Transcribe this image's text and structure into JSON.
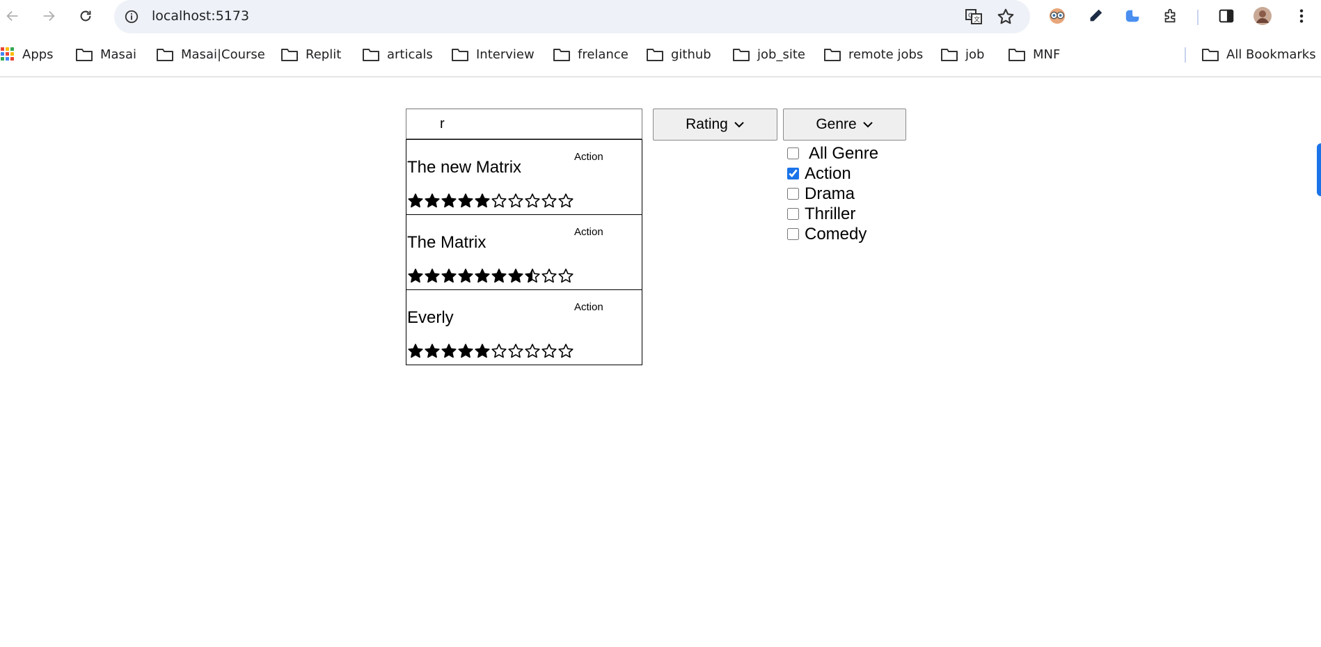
{
  "browser": {
    "url": "localhost:5173",
    "bookmarks": [
      {
        "label": "Apps",
        "icon": "apps-grid-icon"
      },
      {
        "label": "Masai",
        "icon": "folder-icon"
      },
      {
        "label": "Masai|Course",
        "icon": "folder-icon"
      },
      {
        "label": "Replit",
        "icon": "folder-icon"
      },
      {
        "label": "articals",
        "icon": "folder-icon"
      },
      {
        "label": "Interview",
        "icon": "folder-icon"
      },
      {
        "label": "frelance",
        "icon": "folder-icon"
      },
      {
        "label": "github",
        "icon": "folder-icon"
      },
      {
        "label": "job_site",
        "icon": "folder-icon"
      },
      {
        "label": "remote jobs",
        "icon": "folder-icon"
      },
      {
        "label": "job",
        "icon": "folder-icon"
      },
      {
        "label": "MNF",
        "icon": "folder-icon"
      }
    ],
    "all_bookmarks_label": "All Bookmarks"
  },
  "search": {
    "value": "r"
  },
  "rating_dropdown": {
    "label": "Rating"
  },
  "genre_dropdown": {
    "label": "Genre",
    "options": [
      {
        "label": "All Genre",
        "checked": false
      },
      {
        "label": "Action",
        "checked": true
      },
      {
        "label": "Drama",
        "checked": false
      },
      {
        "label": "Thriller",
        "checked": false
      },
      {
        "label": "Comedy",
        "checked": false
      }
    ]
  },
  "movies": [
    {
      "title": "The new Matrix",
      "genre": "Action",
      "rating": 5,
      "max_rating": 10
    },
    {
      "title": "The Matrix",
      "genre": "Action",
      "rating": 7.5,
      "max_rating": 10
    },
    {
      "title": "Everly",
      "genre": "Action",
      "rating": 5,
      "max_rating": 10
    }
  ],
  "colors": {
    "accent": "#1a73e8",
    "omnibox": "#eef1f7"
  }
}
